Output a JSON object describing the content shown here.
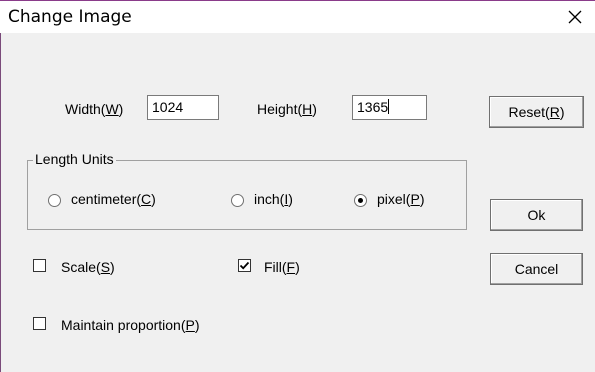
{
  "dialog": {
    "title": "Change Image",
    "close_glyph": "✕"
  },
  "size": {
    "width_label": "Width(",
    "width_key": "W",
    "width_label_end": ")",
    "width_value": "1024",
    "height_label": "Height(",
    "height_key": "H",
    "height_label_end": ")",
    "height_value": "1365"
  },
  "units": {
    "legend": "Length Units",
    "options": [
      {
        "label": "centimeter(",
        "key": "C",
        "end": ")",
        "selected": false
      },
      {
        "label": "inch(",
        "key": "I",
        "end": ")",
        "selected": false
      },
      {
        "label": "pixel(",
        "key": "P",
        "end": ")",
        "selected": true
      }
    ]
  },
  "checkboxes": {
    "scale": {
      "label": "Scale(",
      "key": "S",
      "end": ")",
      "checked": false
    },
    "fill": {
      "label": "Fill(",
      "key": "F",
      "end": ")",
      "checked": true
    },
    "maintain": {
      "label": "Maintain proportion(",
      "key": "P",
      "end": ")",
      "checked": false
    }
  },
  "buttons": {
    "reset": {
      "label": "Reset(",
      "key": "R",
      "end": ")"
    },
    "ok": "Ok",
    "cancel": "Cancel"
  }
}
